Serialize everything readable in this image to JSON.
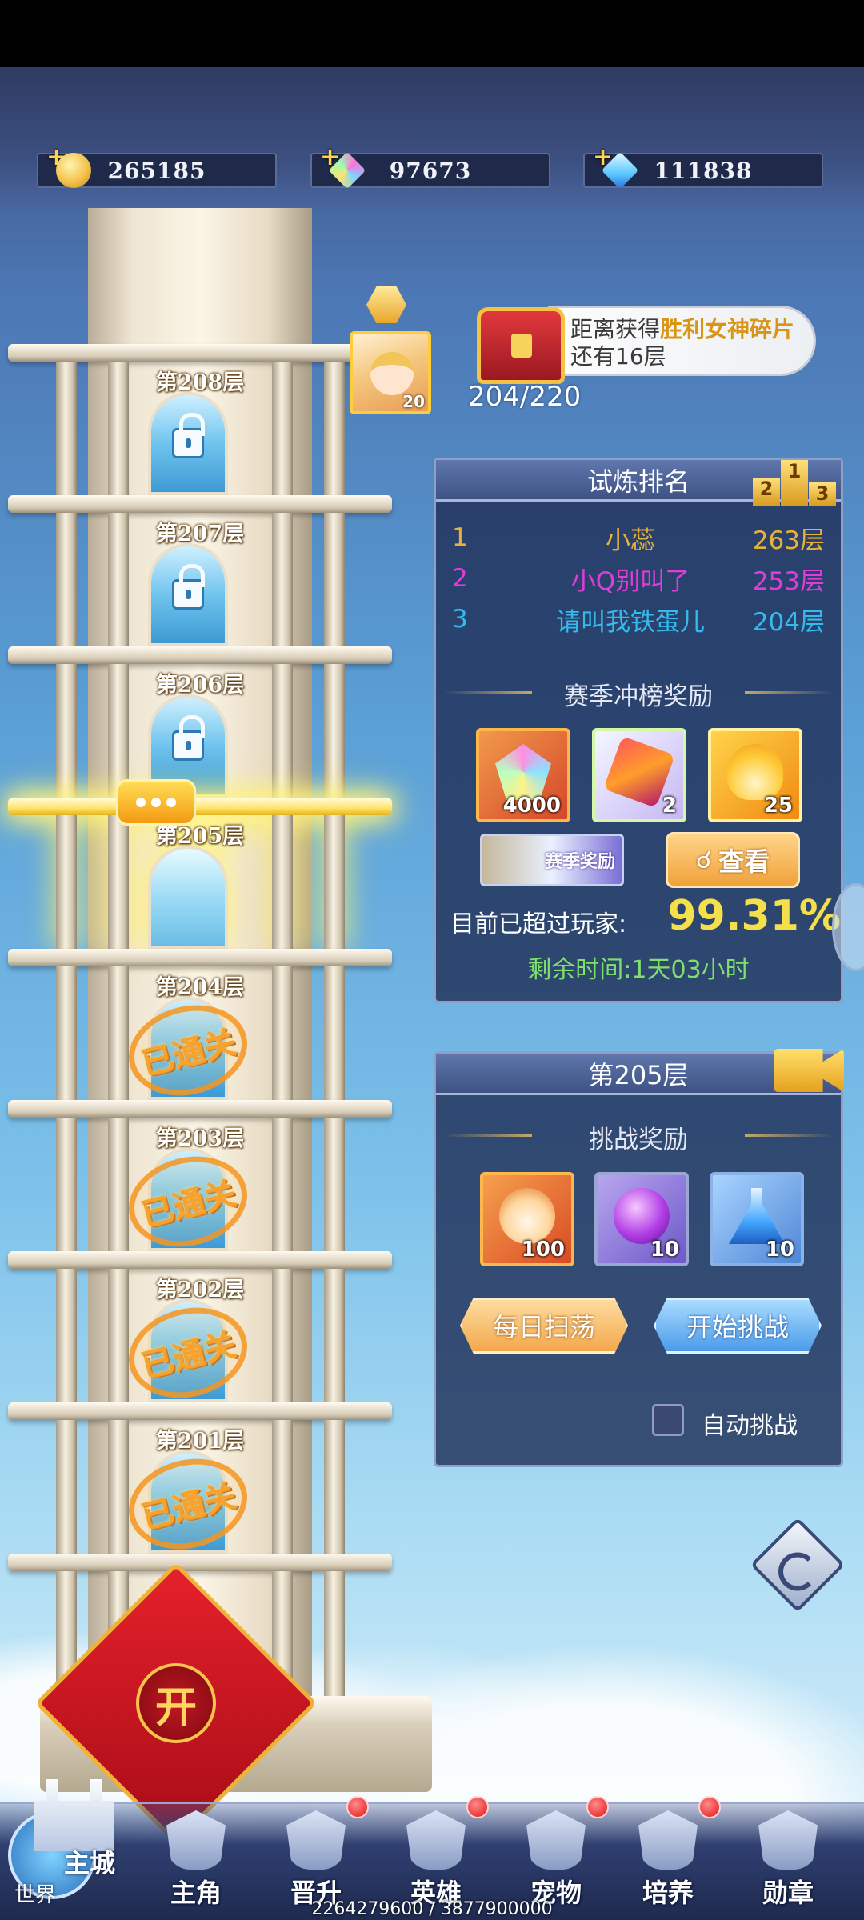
{
  "currencies": [
    {
      "icon": "gold-coin-icon",
      "value": "265185"
    },
    {
      "icon": "rainbow-gem-icon",
      "value": "97673"
    },
    {
      "icon": "blue-diamond-icon",
      "value": "111838"
    }
  ],
  "tower": {
    "floors": [
      {
        "label": "第208层",
        "state": "locked"
      },
      {
        "label": "第207层",
        "state": "locked"
      },
      {
        "label": "第206层",
        "state": "locked"
      },
      {
        "label": "第205层",
        "state": "current"
      },
      {
        "label": "第204层",
        "state": "passed"
      },
      {
        "label": "第203层",
        "state": "passed"
      },
      {
        "label": "第202层",
        "state": "passed"
      },
      {
        "label": "第201层",
        "state": "passed"
      }
    ],
    "passed_stamp": "已通关",
    "avatar_level": "20"
  },
  "goal": {
    "text_prefix": "距离获得",
    "highlight": "胜利女神碎片",
    "text_suffix": "还有16层",
    "progress": "204/220"
  },
  "ranking": {
    "title": "试炼排名",
    "podium": [
      "2",
      "1",
      "3"
    ],
    "rows": [
      {
        "rank": "1",
        "name": "小蕊",
        "floor": "263层",
        "color": "#e7b23a"
      },
      {
        "rank": "2",
        "name": "小Q别叫了",
        "floor": "253层",
        "color": "#e13bd9"
      },
      {
        "rank": "3",
        "name": "请叫我铁蛋儿",
        "floor": "204层",
        "color": "#36b9ec"
      }
    ],
    "season_title": "赛季冲榜奖励",
    "season_rewards": [
      {
        "icon": "rainbow-crystal-icon",
        "count": "4000"
      },
      {
        "icon": "red-shard-icon",
        "count": "2"
      },
      {
        "icon": "gold-flame-icon",
        "count": "25"
      }
    ],
    "season_badge": "赛季奖励",
    "view_button": "查看",
    "surpassed_label": "目前已超过玩家:",
    "surpassed_value": "99.31%",
    "remaining": "剩余时间:1天03小时"
  },
  "challenge": {
    "title": "第205层",
    "rewards_title": "挑战奖励",
    "rewards": [
      {
        "icon": "flame-skull-icon",
        "count": "100"
      },
      {
        "icon": "purple-orb-icon",
        "count": "10"
      },
      {
        "icon": "blue-potion-icon",
        "count": "10"
      }
    ],
    "sweep_button": "每日扫荡",
    "start_button": "开始挑战",
    "auto_label": "自动挑战",
    "auto_checked": false
  },
  "redpack_label": "开",
  "nav": {
    "city_main": "主城",
    "city_world": "世界",
    "items": [
      {
        "label": "主角",
        "dot": false
      },
      {
        "label": "晋升",
        "dot": true
      },
      {
        "label": "英雄",
        "dot": true
      },
      {
        "label": "宠物",
        "dot": true
      },
      {
        "label": "培养",
        "dot": true
      },
      {
        "label": "勋章",
        "dot": false
      }
    ]
  },
  "footer": "2264279600 / 3877900000"
}
